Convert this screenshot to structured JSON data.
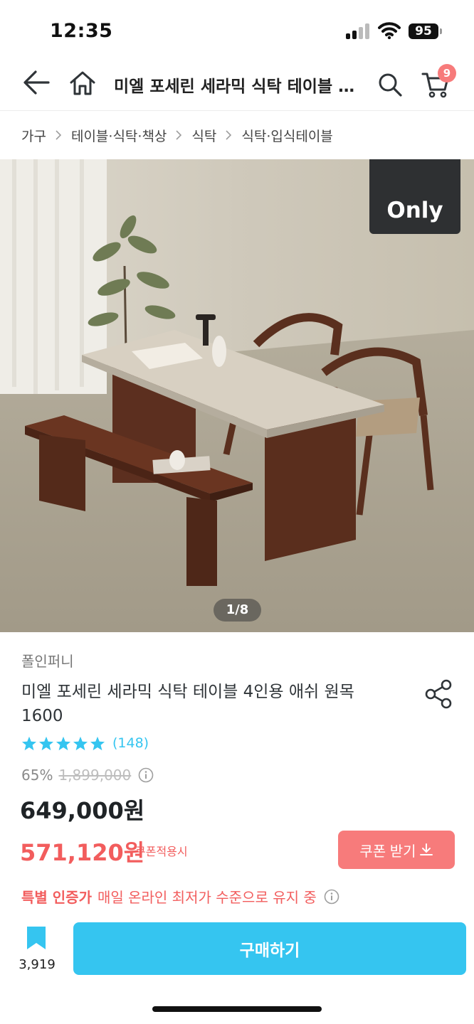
{
  "status_bar": {
    "time": "12:35",
    "battery": "95"
  },
  "header": {
    "title": "미엘 포세린 세라믹 식탁 테이블 4인용 애쉬 원목 1600",
    "cart_count": "9"
  },
  "breadcrumb": [
    "가구",
    "테이블·식탁·책상",
    "식탁",
    "식탁·입식테이블"
  ],
  "gallery": {
    "badge": "Only",
    "counter": "1/8"
  },
  "product": {
    "brand": "폴인퍼니",
    "name": "미엘 포세린 세라믹 식탁 테이블 4인용 애쉬 원목 1600",
    "rating_stars": 5,
    "review_count": "(148)",
    "discount_rate": "65%",
    "original_price": "1,899,000",
    "price": "649,000원",
    "coupon_price": "571,120원",
    "coupon_note": "쿠폰적용시",
    "coupon_button": "쿠폰 받기",
    "cert_label": "특별 인증가",
    "cert_text": "매일 온라인 최저가 수준으로 유지 중"
  },
  "bottom_bar": {
    "bookmark_count": "3,919",
    "buy_button": "구매하기"
  },
  "colors": {
    "accent": "#35c5f0",
    "coupon": "#f77b7b",
    "sale_text": "#f25d5d"
  }
}
